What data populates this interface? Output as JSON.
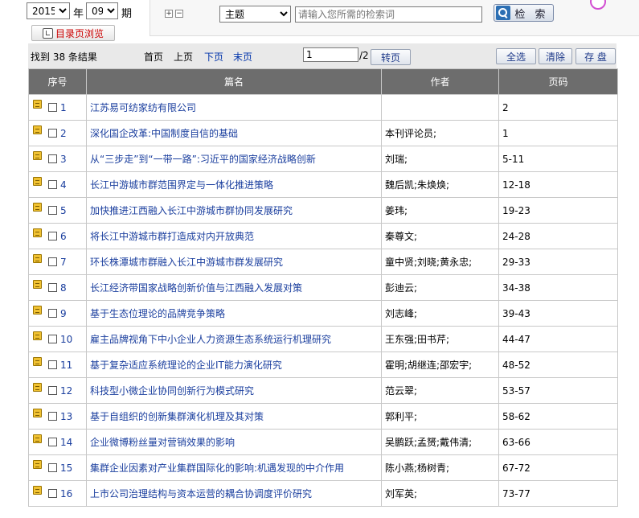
{
  "filters": {
    "year": "2015",
    "year_label": "年",
    "issue": "09",
    "issue_label": "期"
  },
  "toc_button": "目录页浏览",
  "search": {
    "expand": "+",
    "collapse": "−",
    "field": "主题",
    "keyword_placeholder": "请输入您所需的检索词",
    "button": "检 索"
  },
  "toolbar": {
    "result_text": "找到 38 条结果",
    "first": "首页",
    "prev": "上页",
    "next": "下页",
    "last": "末页",
    "page_value": "1",
    "page_total": "/2",
    "go": "转页",
    "select_all": "全选",
    "clear": "清除",
    "save": "存 盘"
  },
  "table": {
    "headers": [
      "序号",
      "篇名",
      "作者",
      "页码"
    ],
    "rows": [
      {
        "no": "1",
        "title": "江苏易可纺家纺有限公司",
        "author": "",
        "pages": "2"
      },
      {
        "no": "2",
        "title": "深化国企改革:中国制度自信的基础",
        "author": "本刊评论员;",
        "pages": "1"
      },
      {
        "no": "3",
        "title": "从“三步走”到“一带一路”:习近平的国家经济战略创新",
        "author": "刘瑞;",
        "pages": "5-11"
      },
      {
        "no": "4",
        "title": "长江中游城市群范围界定与一体化推进策略",
        "author": "魏后凯;朱焕焕;",
        "pages": "12-18"
      },
      {
        "no": "5",
        "title": "加快推进江西融入长江中游城市群协同发展研究",
        "author": "姜玮;",
        "pages": "19-23"
      },
      {
        "no": "6",
        "title": "将长江中游城市群打造成对内开放典范",
        "author": "秦尊文;",
        "pages": "24-28"
      },
      {
        "no": "7",
        "title": "环长株潭城市群融入长江中游城市群发展研究",
        "author": "童中贤;刘晓;黄永忠;",
        "pages": "29-33"
      },
      {
        "no": "8",
        "title": "长江经济带国家战略创新价值与江西融入发展对策",
        "author": "彭迪云;",
        "pages": "34-38"
      },
      {
        "no": "9",
        "title": "基于生态位理论的品牌竞争策略",
        "author": "刘志峰;",
        "pages": "39-43"
      },
      {
        "no": "10",
        "title": "雇主品牌视角下中小企业人力资源生态系统运行机理研究",
        "author": "王东强;田书芹;",
        "pages": "44-47"
      },
      {
        "no": "11",
        "title": "基于复杂适应系统理论的企业IT能力演化研究",
        "author": "霍明;胡继连;邵宏宇;",
        "pages": "48-52"
      },
      {
        "no": "12",
        "title": "科技型小微企业协同创新行为模式研究",
        "author": "范云翠;",
        "pages": "53-57"
      },
      {
        "no": "13",
        "title": "基于自组织的创新集群演化机理及其对策",
        "author": "郭利平;",
        "pages": "58-62"
      },
      {
        "no": "14",
        "title": "企业微博粉丝量对营销效果的影响",
        "author": "吴鹏跃;孟赟;戴伟清;",
        "pages": "63-66"
      },
      {
        "no": "15",
        "title": "集群企业因素对产业集群国际化的影响:机遇发现的中介作用",
        "author": "陈小燕;杨树青;",
        "pages": "67-72"
      },
      {
        "no": "16",
        "title": "上市公司治理结构与资本运营的耦合协调度评价研究",
        "author": "刘军英;",
        "pages": "73-77"
      }
    ]
  }
}
